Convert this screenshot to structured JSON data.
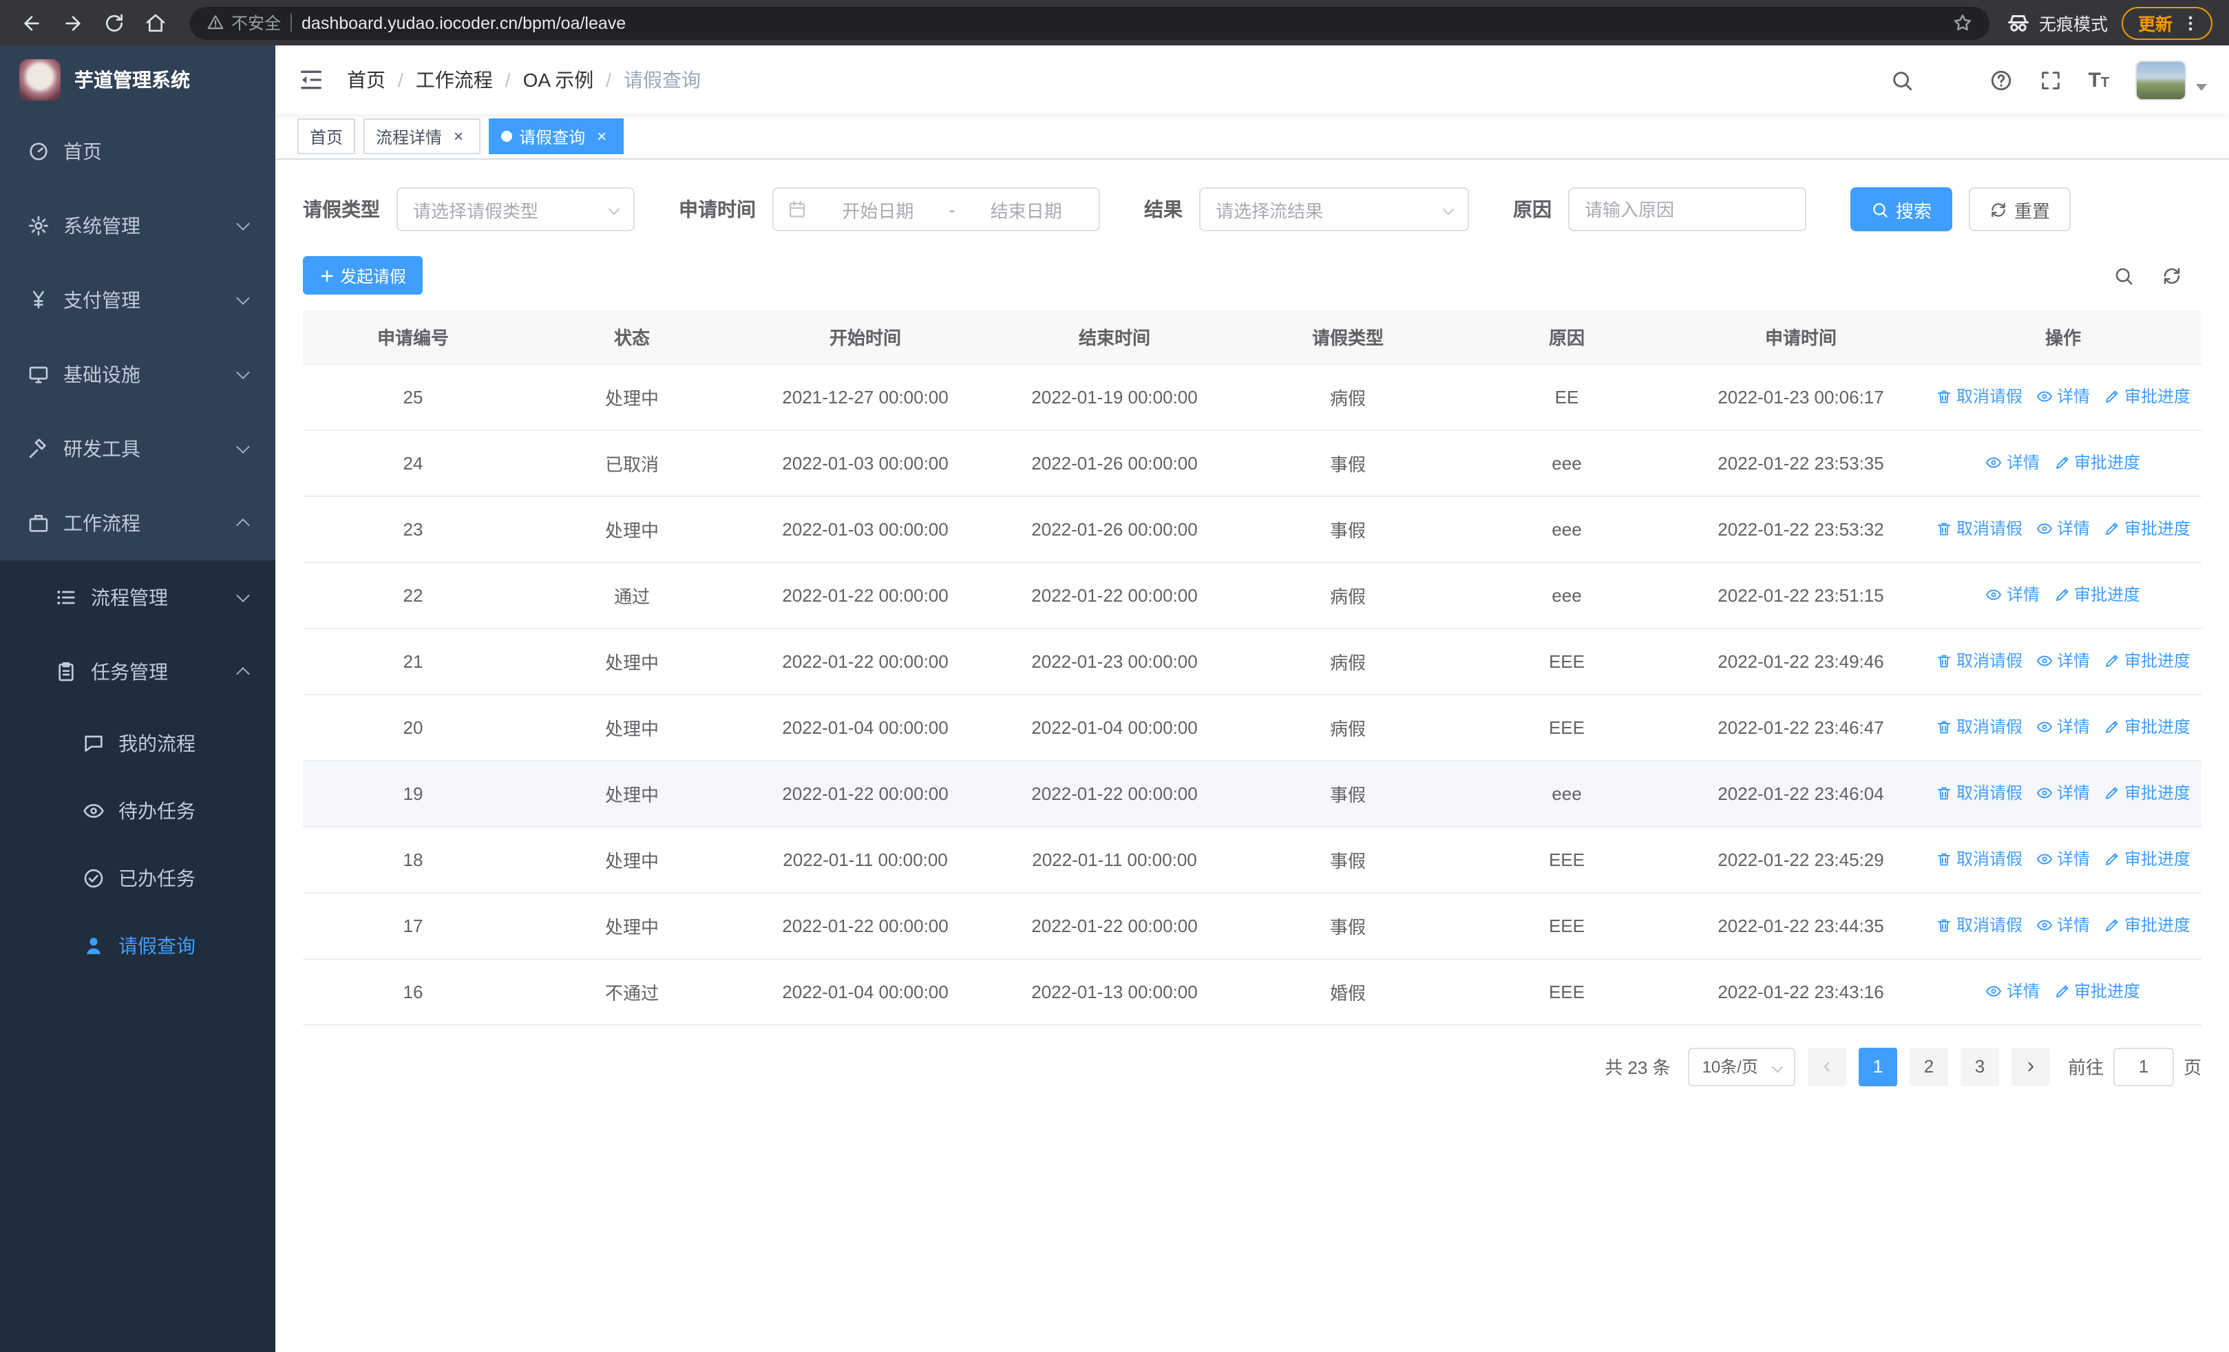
{
  "colors": {
    "accent": "#409EFF",
    "sidebar_bg": "#304156",
    "sidebar_sub_bg": "#1f2d3d",
    "update_orange": "#f29900"
  },
  "browser": {
    "security_label": "不安全",
    "url": "dashboard.yudao.iocoder.cn/bpm/oa/leave",
    "incognito_label": "无痕模式",
    "update_label": "更新"
  },
  "sidebar": {
    "logo_title": "芋道管理系统",
    "items": [
      {
        "key": "home",
        "label": "首页",
        "icon": "gauge-icon",
        "expandable": false
      },
      {
        "key": "system",
        "label": "系统管理",
        "icon": "gear-icon",
        "expandable": true
      },
      {
        "key": "payment",
        "label": "支付管理",
        "icon": "yen-icon",
        "expandable": true
      },
      {
        "key": "infra",
        "label": "基础设施",
        "icon": "monitor-icon",
        "expandable": true
      },
      {
        "key": "devtools",
        "label": "研发工具",
        "icon": "tools-icon",
        "expandable": true
      },
      {
        "key": "workflow",
        "label": "工作流程",
        "icon": "briefcase-icon",
        "expandable": true,
        "expanded": true
      }
    ],
    "submenu": [
      {
        "key": "process-mgmt",
        "label": "流程管理",
        "icon": "list-icon",
        "level": 1,
        "expandable": true
      },
      {
        "key": "task-mgmt",
        "label": "任务管理",
        "icon": "clipboard-icon",
        "level": 1,
        "expandable": true,
        "expanded": true
      },
      {
        "key": "my-process",
        "label": "我的流程",
        "icon": "chat-icon",
        "level": 2
      },
      {
        "key": "todo-task",
        "label": "待办任务",
        "icon": "eye-icon",
        "level": 2
      },
      {
        "key": "done-task",
        "label": "已办任务",
        "icon": "done-icon",
        "level": 2
      },
      {
        "key": "leave-query",
        "label": "请假查询",
        "icon": "user-icon",
        "level": 2,
        "active": true
      }
    ]
  },
  "header": {
    "breadcrumbs": [
      "首页",
      "工作流程",
      "OA 示例",
      "请假查询"
    ]
  },
  "tabs": [
    {
      "label": "首页",
      "closable": false,
      "active": false
    },
    {
      "label": "流程详情",
      "closable": true,
      "active": false
    },
    {
      "label": "请假查询",
      "closable": true,
      "active": true
    }
  ],
  "filters": {
    "leave_type_label": "请假类型",
    "leave_type_placeholder": "请选择请假类型",
    "apply_time_label": "申请时间",
    "start_date_placeholder": "开始日期",
    "range_separator": "-",
    "end_date_placeholder": "结束日期",
    "result_label": "结果",
    "result_placeholder": "请选择流结果",
    "reason_label": "原因",
    "reason_placeholder": "请输入原因",
    "search_label": "搜索",
    "reset_label": "重置"
  },
  "toolbar": {
    "create_label": "发起请假"
  },
  "table": {
    "columns": [
      "申请编号",
      "状态",
      "开始时间",
      "结束时间",
      "请假类型",
      "原因",
      "申请时间",
      "操作"
    ],
    "action_labels": {
      "cancel": "取消请假",
      "detail": "详情",
      "progress": "审批进度"
    },
    "rows": [
      {
        "id": "25",
        "status": "处理中",
        "start": "2021-12-27 00:00:00",
        "end": "2022-01-19 00:00:00",
        "type": "病假",
        "reason": "EE",
        "applied": "2022-01-23 00:06:17",
        "actions": [
          "cancel",
          "detail",
          "progress"
        ]
      },
      {
        "id": "24",
        "status": "已取消",
        "start": "2022-01-03 00:00:00",
        "end": "2022-01-26 00:00:00",
        "type": "事假",
        "reason": "eee",
        "applied": "2022-01-22 23:53:35",
        "actions": [
          "detail",
          "progress"
        ]
      },
      {
        "id": "23",
        "status": "处理中",
        "start": "2022-01-03 00:00:00",
        "end": "2022-01-26 00:00:00",
        "type": "事假",
        "reason": "eee",
        "applied": "2022-01-22 23:53:32",
        "actions": [
          "cancel",
          "detail",
          "progress"
        ]
      },
      {
        "id": "22",
        "status": "通过",
        "start": "2022-01-22 00:00:00",
        "end": "2022-01-22 00:00:00",
        "type": "病假",
        "reason": "eee",
        "applied": "2022-01-22 23:51:15",
        "actions": [
          "detail",
          "progress"
        ]
      },
      {
        "id": "21",
        "status": "处理中",
        "start": "2022-01-22 00:00:00",
        "end": "2022-01-23 00:00:00",
        "type": "病假",
        "reason": "EEE",
        "applied": "2022-01-22 23:49:46",
        "actions": [
          "cancel",
          "detail",
          "progress"
        ]
      },
      {
        "id": "20",
        "status": "处理中",
        "start": "2022-01-04 00:00:00",
        "end": "2022-01-04 00:00:00",
        "type": "病假",
        "reason": "EEE",
        "applied": "2022-01-22 23:46:47",
        "actions": [
          "cancel",
          "detail",
          "progress"
        ]
      },
      {
        "id": "19",
        "status": "处理中",
        "start": "2022-01-22 00:00:00",
        "end": "2022-01-22 00:00:00",
        "type": "事假",
        "reason": "eee",
        "applied": "2022-01-22 23:46:04",
        "actions": [
          "cancel",
          "detail",
          "progress"
        ],
        "highlight": true
      },
      {
        "id": "18",
        "status": "处理中",
        "start": "2022-01-11 00:00:00",
        "end": "2022-01-11 00:00:00",
        "type": "事假",
        "reason": "EEE",
        "applied": "2022-01-22 23:45:29",
        "actions": [
          "cancel",
          "detail",
          "progress"
        ]
      },
      {
        "id": "17",
        "status": "处理中",
        "start": "2022-01-22 00:00:00",
        "end": "2022-01-22 00:00:00",
        "type": "事假",
        "reason": "EEE",
        "applied": "2022-01-22 23:44:35",
        "actions": [
          "cancel",
          "detail",
          "progress"
        ]
      },
      {
        "id": "16",
        "status": "不通过",
        "start": "2022-01-04 00:00:00",
        "end": "2022-01-13 00:00:00",
        "type": "婚假",
        "reason": "EEE",
        "applied": "2022-01-22 23:43:16",
        "actions": [
          "detail",
          "progress"
        ]
      }
    ]
  },
  "pagination": {
    "total_label": "共 23 条",
    "page_size": "10条/页",
    "pages": [
      "1",
      "2",
      "3"
    ],
    "active_page": "1",
    "goto_label": "前往",
    "goto_value": "1",
    "page_label": "页"
  }
}
